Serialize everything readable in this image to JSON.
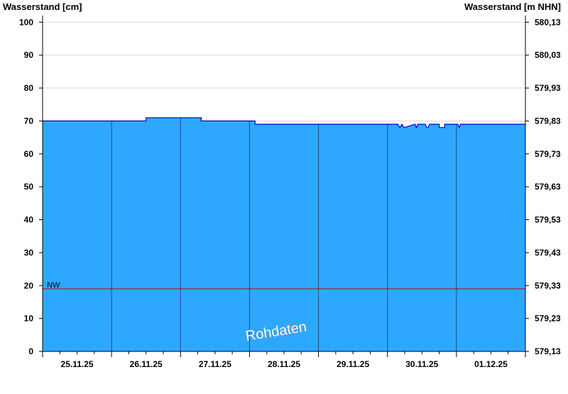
{
  "chart_data": {
    "type": "area",
    "title": "",
    "ylabel_left": "Wasserstand [cm]",
    "ylabel_right": "Wasserstand [m NHN]",
    "ylim": [
      0,
      102
    ],
    "y_ticks": [
      0,
      10,
      20,
      30,
      40,
      50,
      60,
      70,
      80,
      90,
      100
    ],
    "y_right_ticks": [
      "579,13",
      "579,23",
      "579,33",
      "579,43",
      "579,53",
      "579,63",
      "579,73",
      "579,83",
      "579,93",
      "580,03",
      "580,13"
    ],
    "x_day_labels": [
      "25.11.25",
      "26.11.25",
      "27.11.25",
      "28.11.25",
      "29.11.25",
      "30.11.25",
      "01.12.25"
    ],
    "x_range_days": [
      0,
      7
    ],
    "grid": true,
    "colors": {
      "fill": "#2ea8ff",
      "line": "#0000cc",
      "reference": "#cc0000",
      "grid": "#d8d8d8",
      "day_line": "#1a4f80"
    },
    "series": [
      {
        "x": [
          0,
          1.5,
          1.5,
          2.3,
          2.3,
          3.08,
          3.08,
          5.15,
          5.18,
          5.21,
          5.24,
          5.4,
          5.42,
          5.44,
          5.55,
          5.57,
          5.59,
          5.61,
          5.75,
          5.75,
          5.83,
          5.83,
          6.02,
          6.04,
          6.06,
          7
        ],
        "values": [
          70,
          70,
          71,
          71,
          70,
          70,
          69,
          69,
          68,
          69,
          68,
          69,
          68,
          69,
          69,
          68,
          68,
          69,
          69,
          68,
          68,
          69,
          69,
          68,
          69,
          69
        ]
      }
    ],
    "reference_lines": [
      {
        "label": "NW",
        "value": 19
      }
    ],
    "annotations": [
      "Rohdaten"
    ]
  }
}
